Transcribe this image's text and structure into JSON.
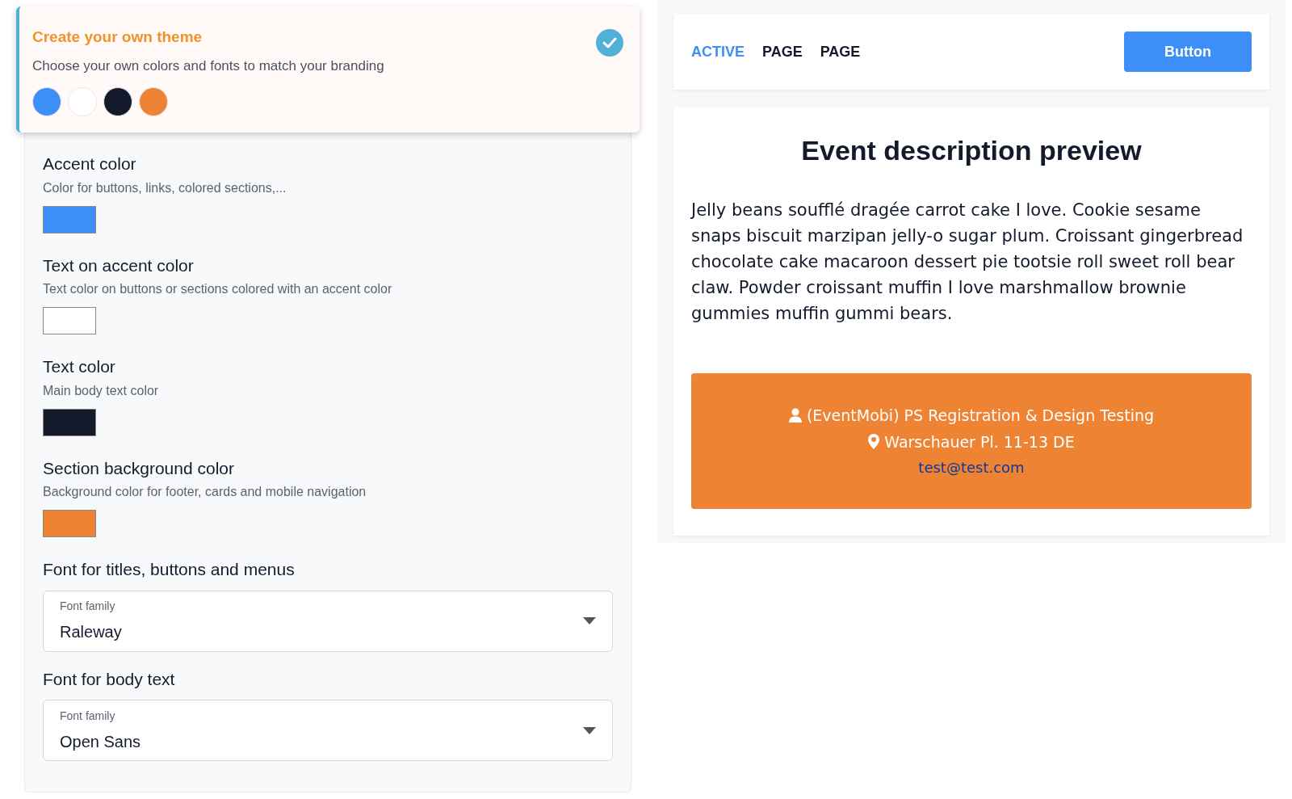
{
  "theme_card": {
    "title": "Create your own theme",
    "subtitle": "Choose your own colors and fonts to match your branding",
    "selected": true,
    "swatches": [
      {
        "color": "#3d8ef7"
      },
      {
        "color": "#ffffff"
      },
      {
        "color": "#131a2c"
      },
      {
        "color": "#ee8333"
      }
    ]
  },
  "color_settings": [
    {
      "label": "Accent color",
      "description": "Color for buttons, links, colored sections,...",
      "color": "#3d8ef7"
    },
    {
      "label": "Text on accent color",
      "description": "Text color on buttons or sections colored with an accent color",
      "color": "#ffffff"
    },
    {
      "label": "Text color",
      "description": "Main body text color",
      "color": "#131a2c"
    },
    {
      "label": "Section background color",
      "description": "Background color for footer, cards and mobile navigation",
      "color": "#ee8333"
    }
  ],
  "font_settings": [
    {
      "label": "Font for titles, buttons and menus",
      "field_label": "Font family",
      "value": "Raleway"
    },
    {
      "label": "Font for body text",
      "field_label": "Font family",
      "value": "Open Sans"
    }
  ],
  "preview": {
    "nav": [
      {
        "label": "ACTIVE",
        "selected": true
      },
      {
        "label": "PAGE",
        "selected": false
      },
      {
        "label": "PAGE",
        "selected": false
      }
    ],
    "button": "Button",
    "title": "Event description preview",
    "body": "Jelly beans soufflé dragée carrot cake I love. Cookie sesame snaps biscuit marzipan jelly-o sugar plum. Croissant gingerbread chocolate cake macaroon dessert pie tootsie roll sweet roll bear claw. Powder croissant muffin I love marshmallow brownie gummies muffin gummi bears.",
    "organizer": "(EventMobi) PS Registration & Design Testing",
    "location": "Warschauer Pl. 11-13 DE",
    "email": "test@test.com"
  }
}
